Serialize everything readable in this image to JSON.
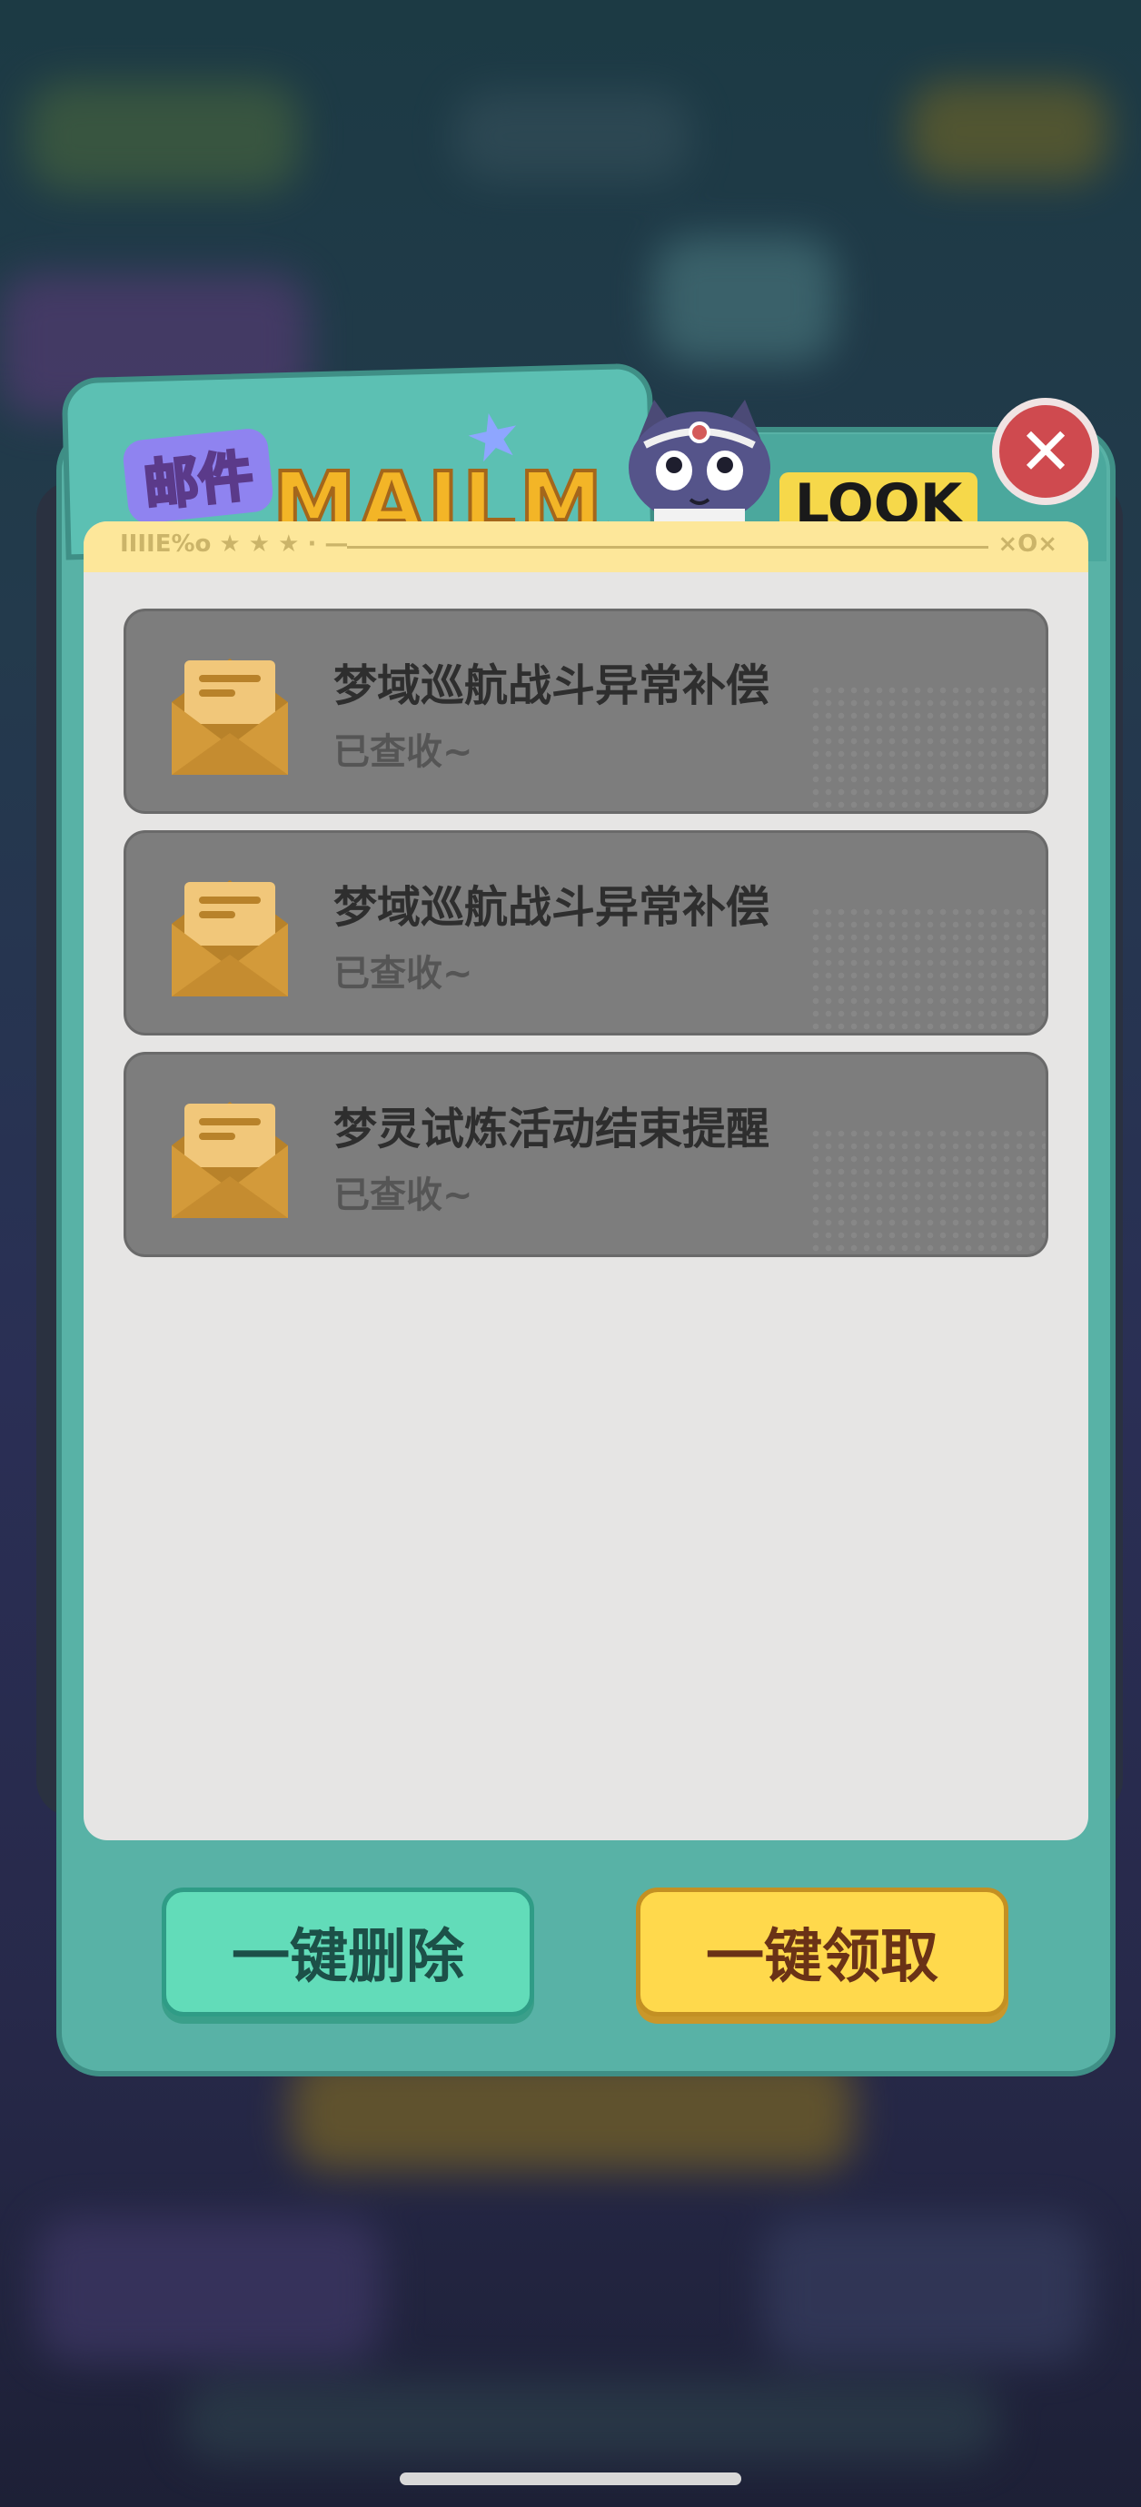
{
  "modal": {
    "badge": "邮件",
    "banner_en": "MAILMA",
    "look": "LOOK",
    "close_symbol": "✕",
    "strip_left": "IIIIE%o ★ ★ ★ · —",
    "strip_right": "×O×"
  },
  "mails": [
    {
      "title": "梦域巡航战斗异常补偿",
      "status": "已查收~",
      "icon": "envelope-open-icon"
    },
    {
      "title": "梦域巡航战斗异常补偿",
      "status": "已查收~",
      "icon": "envelope-open-icon"
    },
    {
      "title": "梦灵试炼活动结束提醒",
      "status": "已查收~",
      "icon": "envelope-open-icon"
    }
  ],
  "footer": {
    "delete_all": "一键删除",
    "claim_all": "一键领取"
  },
  "colors": {
    "panel": "#58b2a6",
    "close": "#cf4a4f",
    "delete_button": "#62dcb9",
    "claim_button": "#ffd94c",
    "mail_item": "#7d7d7d"
  }
}
